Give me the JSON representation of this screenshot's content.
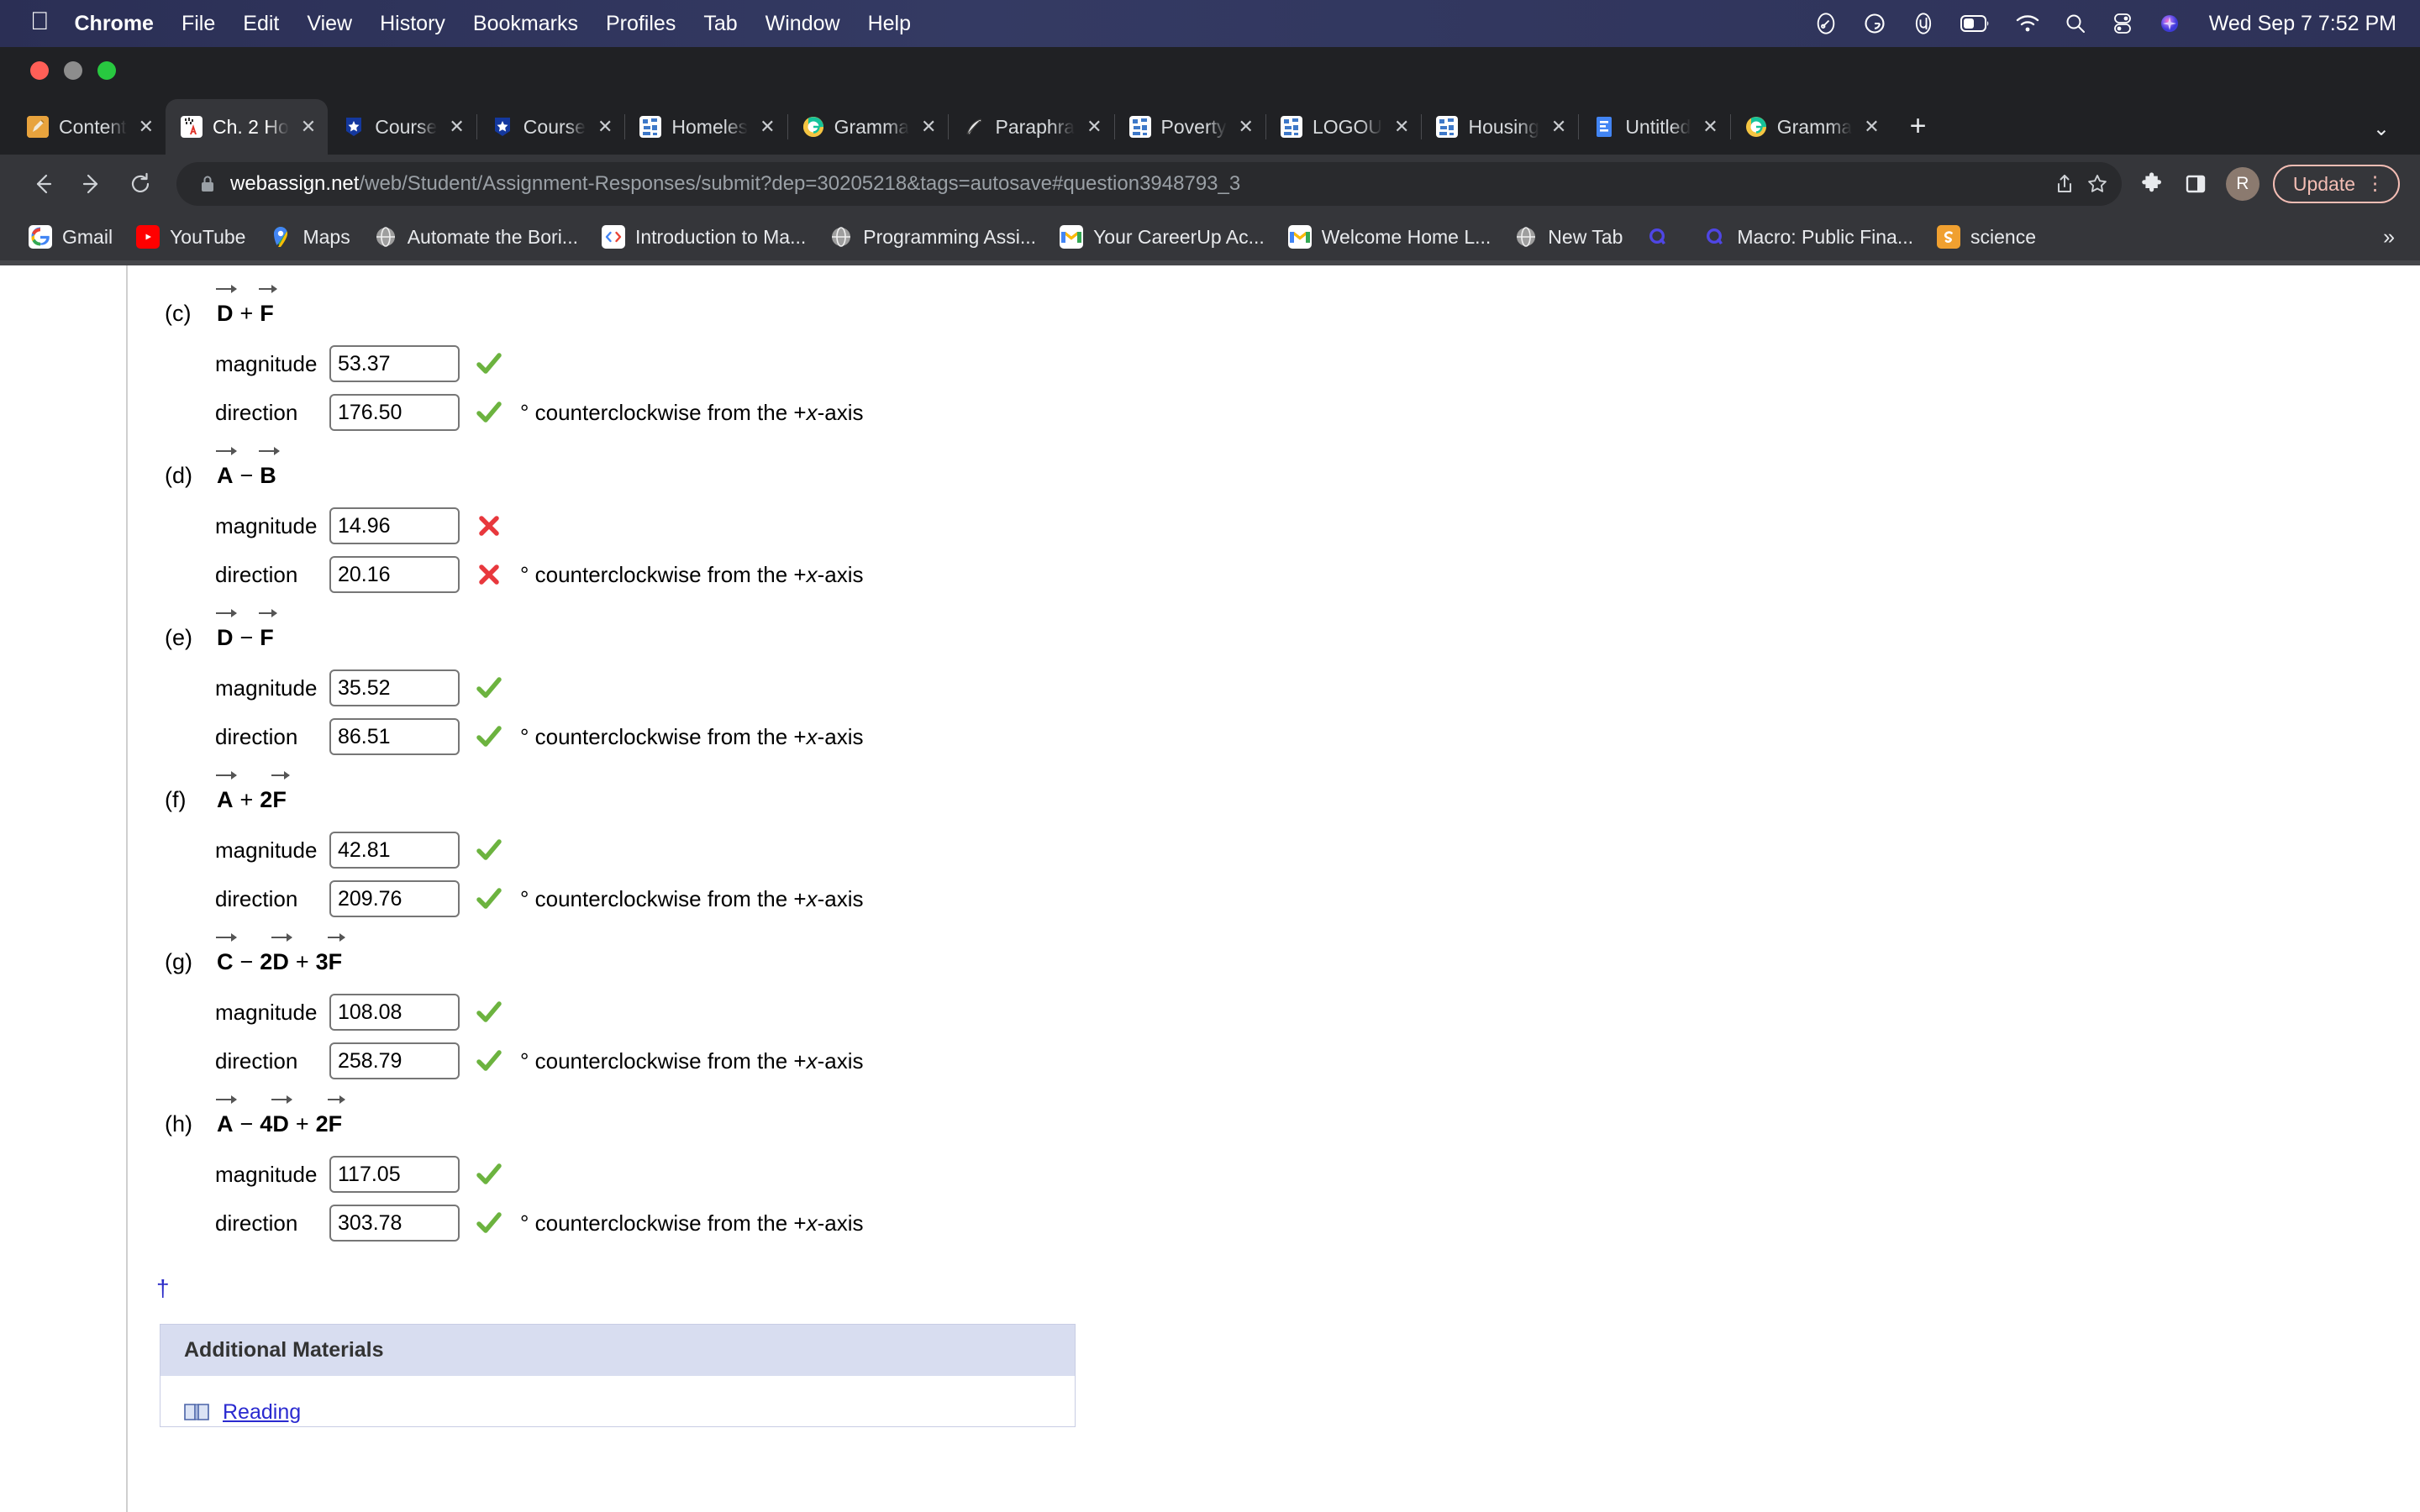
{
  "menubar": {
    "apple": "",
    "items": [
      {
        "label": "Chrome",
        "bold": true
      },
      {
        "label": "File",
        "bold": false
      },
      {
        "label": "Edit",
        "bold": false
      },
      {
        "label": "View",
        "bold": false
      },
      {
        "label": "History",
        "bold": false
      },
      {
        "label": "Bookmarks",
        "bold": false
      },
      {
        "label": "Profiles",
        "bold": false
      },
      {
        "label": "Tab",
        "bold": false
      },
      {
        "label": "Window",
        "bold": false
      },
      {
        "label": "Help",
        "bold": false
      }
    ],
    "status_icons": [
      "evernote-icon",
      "grammarly-icon",
      "utorrent-icon",
      "battery-icon",
      "wifi-icon",
      "spotlight-search-icon",
      "control-center-icon",
      "siri-icon"
    ],
    "clock": "Wed Sep 7  7:52 PM"
  },
  "browser": {
    "window_controls": [
      "close-button",
      "minimize-button",
      "maximize-button"
    ],
    "tabs": [
      {
        "title": "Content",
        "favicon": "pencil-notebook-icon",
        "active": false
      },
      {
        "title": "Ch. 2 Ho",
        "favicon": "webassign-icon",
        "active": true
      },
      {
        "title": "Course",
        "favicon": "star-shield-icon",
        "active": false
      },
      {
        "title": "Course",
        "favicon": "star-shield-icon",
        "active": false
      },
      {
        "title": "Homeles",
        "favicon": "doc-icon",
        "active": false
      },
      {
        "title": "Gramma",
        "favicon": "grammarly-icon",
        "active": false
      },
      {
        "title": "Paraphra",
        "favicon": "quill-pen-icon",
        "active": false
      },
      {
        "title": "Poverty",
        "favicon": "doc-icon",
        "active": false
      },
      {
        "title": "LOGOU",
        "favicon": "doc-icon",
        "active": false
      },
      {
        "title": "Housing",
        "favicon": "doc-icon",
        "active": false
      },
      {
        "title": "Untitled",
        "favicon": "google-docs-icon",
        "active": false
      },
      {
        "title": "Gramma",
        "favicon": "grammarly-icon",
        "active": false
      }
    ],
    "new_tab_label": "+",
    "tab_list_chevron": "chevron-down-icon",
    "nav": {
      "back": "back-arrow-icon",
      "forward": "forward-arrow-icon",
      "reload": "reload-icon"
    },
    "omnibox": {
      "lock": "lock-icon",
      "host": "webassign.net",
      "path": "/web/Student/Assignment-Responses/submit?dep=30205218&tags=autosave#question3948793_3",
      "share_icon": "share-icon",
      "bookmark_icon": "star-outline-icon"
    },
    "toolbar_icons": [
      "extensions-puzzle-icon",
      "side-panel-icon"
    ],
    "profile_initial": "R",
    "update_label": "Update",
    "kebab": "⋮",
    "bookmarks": [
      {
        "label": "Gmail",
        "icon": "google-g-icon"
      },
      {
        "label": "YouTube",
        "icon": "youtube-icon"
      },
      {
        "label": "Maps",
        "icon": "maps-pin-icon"
      },
      {
        "label": "Automate the Bori...",
        "icon": "globe-icon"
      },
      {
        "label": "Introduction to Ma...",
        "icon": "code-brackets-icon"
      },
      {
        "label": "Programming Assi...",
        "icon": "globe-icon"
      },
      {
        "label": "Your CareerUp Ac...",
        "icon": "gmail-m-icon"
      },
      {
        "label": "Welcome Home L...",
        "icon": "gmail-m-icon"
      },
      {
        "label": "New Tab",
        "icon": "globe-icon"
      },
      {
        "label": "",
        "icon": "quora-q-icon"
      },
      {
        "label": "Macro: Public Fina...",
        "icon": "quora-q-icon"
      },
      {
        "label": "science",
        "icon": "scribd-s-icon"
      }
    ],
    "bookmarks_overflow": "»"
  },
  "question": {
    "unit_note_prefix": "° counterclockwise from the +",
    "unit_note_italic": "x",
    "unit_note_suffix": "-axis",
    "magnitude_label": "magnitude",
    "direction_label": "direction",
    "correct_mark": "check-mark-icon",
    "incorrect_mark": "cross-mark-icon",
    "dagger": "†",
    "parts": [
      {
        "label": "(c)",
        "expression": [
          {
            "type": "vector",
            "text": "D"
          },
          {
            "type": "op",
            "text": "+"
          },
          {
            "type": "vector",
            "text": "F"
          }
        ],
        "magnitude": {
          "value": "53.37",
          "status": "correct"
        },
        "direction": {
          "value": "176.50",
          "status": "correct"
        }
      },
      {
        "label": "(d)",
        "expression": [
          {
            "type": "vector",
            "text": "A"
          },
          {
            "type": "op",
            "text": "−"
          },
          {
            "type": "vector",
            "text": "B"
          }
        ],
        "magnitude": {
          "value": "14.96",
          "status": "incorrect"
        },
        "direction": {
          "value": "20.16",
          "status": "incorrect"
        }
      },
      {
        "label": "(e)",
        "expression": [
          {
            "type": "vector",
            "text": "D"
          },
          {
            "type": "op",
            "text": "−"
          },
          {
            "type": "vector",
            "text": "F"
          }
        ],
        "magnitude": {
          "value": "35.52",
          "status": "correct"
        },
        "direction": {
          "value": "86.51",
          "status": "correct"
        }
      },
      {
        "label": "(f)",
        "expression": [
          {
            "type": "vector",
            "text": "A"
          },
          {
            "type": "op",
            "text": "+"
          },
          {
            "type": "coef",
            "text": "2"
          },
          {
            "type": "vector",
            "text": "F"
          }
        ],
        "magnitude": {
          "value": "42.81",
          "status": "correct"
        },
        "direction": {
          "value": "209.76",
          "status": "correct"
        }
      },
      {
        "label": "(g)",
        "expression": [
          {
            "type": "vector",
            "text": "C"
          },
          {
            "type": "op",
            "text": "−"
          },
          {
            "type": "coef",
            "text": "2"
          },
          {
            "type": "vector",
            "text": "D"
          },
          {
            "type": "op",
            "text": "+"
          },
          {
            "type": "coef",
            "text": "3"
          },
          {
            "type": "vector",
            "text": "F"
          }
        ],
        "magnitude": {
          "value": "108.08",
          "status": "correct"
        },
        "direction": {
          "value": "258.79",
          "status": "correct"
        }
      },
      {
        "label": "(h)",
        "expression": [
          {
            "type": "vector",
            "text": "A"
          },
          {
            "type": "op",
            "text": "−"
          },
          {
            "type": "coef",
            "text": "4"
          },
          {
            "type": "vector",
            "text": "D"
          },
          {
            "type": "op",
            "text": "+"
          },
          {
            "type": "coef",
            "text": "2"
          },
          {
            "type": "vector",
            "text": "F"
          }
        ],
        "magnitude": {
          "value": "117.05",
          "status": "correct"
        },
        "direction": {
          "value": "303.78",
          "status": "correct"
        }
      }
    ]
  },
  "additional_materials": {
    "title": "Additional Materials",
    "items": [
      {
        "label": "Reading",
        "icon": "book-icon"
      }
    ]
  }
}
